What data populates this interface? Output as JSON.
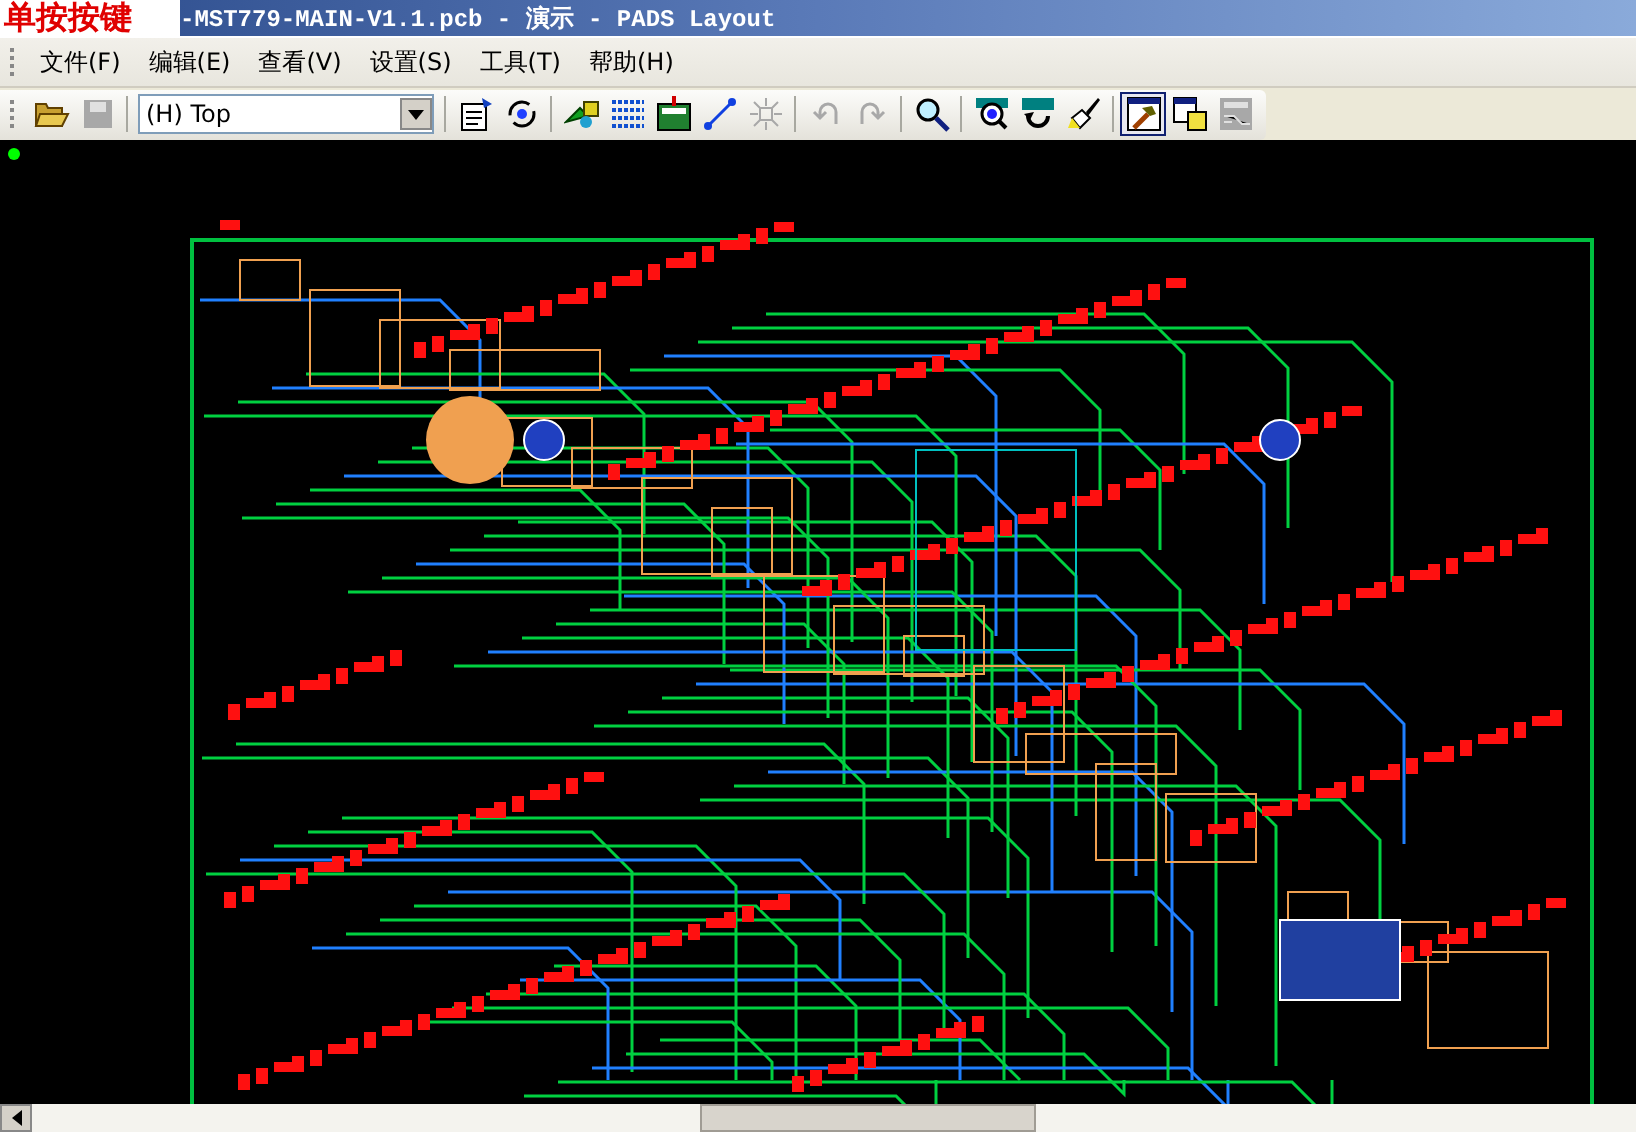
{
  "title_bar": {
    "caption": "单按按键",
    "title": "-MST779-MAIN-V1.1.pcb - 演示 - PADS Layout"
  },
  "menu": [
    "文件(F)",
    "编辑(E)",
    "查看(V)",
    "设置(S)",
    "工具(T)",
    "帮助(H)"
  ],
  "toolbar": {
    "layer_dropdown": {
      "value": "(H) Top"
    },
    "button_groups": [
      [
        {
          "kind": "open",
          "disabled": false,
          "selected": false
        },
        {
          "kind": "save",
          "disabled": true,
          "selected": false
        }
      ],
      [
        {
          "kind": "properties",
          "disabled": false,
          "selected": false
        },
        {
          "kind": "refresh",
          "disabled": false,
          "selected": false
        }
      ],
      [
        {
          "kind": "shape",
          "disabled": false,
          "selected": false
        },
        {
          "kind": "pour",
          "disabled": false,
          "selected": false
        },
        {
          "kind": "board",
          "disabled": false,
          "selected": false
        },
        {
          "kind": "route",
          "disabled": false,
          "selected": false
        },
        {
          "kind": "spread",
          "disabled": true,
          "selected": false
        }
      ],
      [
        {
          "kind": "undo",
          "disabled": true,
          "selected": false
        },
        {
          "kind": "redo",
          "disabled": true,
          "selected": false
        }
      ],
      [
        {
          "kind": "zoom",
          "disabled": false,
          "selected": false
        }
      ],
      [
        {
          "kind": "view",
          "disabled": false,
          "selected": false
        },
        {
          "kind": "redraw",
          "disabled": false,
          "selected": false
        },
        {
          "kind": "paint",
          "disabled": false,
          "selected": false
        }
      ],
      [
        {
          "kind": "select",
          "disabled": false,
          "selected": true
        },
        {
          "kind": "window",
          "disabled": false,
          "selected": false
        },
        {
          "kind": "logo",
          "disabled": true,
          "selected": false
        }
      ]
    ]
  }
}
